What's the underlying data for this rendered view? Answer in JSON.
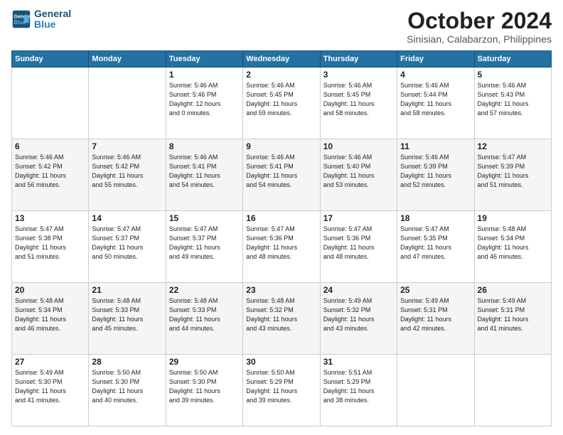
{
  "header": {
    "logo_line1": "General",
    "logo_line2": "Blue",
    "month_title": "October 2024",
    "subtitle": "Sinisian, Calabarzon, Philippines"
  },
  "days_of_week": [
    "Sunday",
    "Monday",
    "Tuesday",
    "Wednesday",
    "Thursday",
    "Friday",
    "Saturday"
  ],
  "weeks": [
    [
      {
        "num": "",
        "info": ""
      },
      {
        "num": "",
        "info": ""
      },
      {
        "num": "1",
        "info": "Sunrise: 5:46 AM\nSunset: 5:46 PM\nDaylight: 12 hours\nand 0 minutes."
      },
      {
        "num": "2",
        "info": "Sunrise: 5:46 AM\nSunset: 5:45 PM\nDaylight: 11 hours\nand 59 minutes."
      },
      {
        "num": "3",
        "info": "Sunrise: 5:46 AM\nSunset: 5:45 PM\nDaylight: 11 hours\nand 58 minutes."
      },
      {
        "num": "4",
        "info": "Sunrise: 5:46 AM\nSunset: 5:44 PM\nDaylight: 11 hours\nand 58 minutes."
      },
      {
        "num": "5",
        "info": "Sunrise: 5:46 AM\nSunset: 5:43 PM\nDaylight: 11 hours\nand 57 minutes."
      }
    ],
    [
      {
        "num": "6",
        "info": "Sunrise: 5:46 AM\nSunset: 5:42 PM\nDaylight: 11 hours\nand 56 minutes."
      },
      {
        "num": "7",
        "info": "Sunrise: 5:46 AM\nSunset: 5:42 PM\nDaylight: 11 hours\nand 55 minutes."
      },
      {
        "num": "8",
        "info": "Sunrise: 5:46 AM\nSunset: 5:41 PM\nDaylight: 11 hours\nand 54 minutes."
      },
      {
        "num": "9",
        "info": "Sunrise: 5:46 AM\nSunset: 5:41 PM\nDaylight: 11 hours\nand 54 minutes."
      },
      {
        "num": "10",
        "info": "Sunrise: 5:46 AM\nSunset: 5:40 PM\nDaylight: 11 hours\nand 53 minutes."
      },
      {
        "num": "11",
        "info": "Sunrise: 5:46 AM\nSunset: 5:39 PM\nDaylight: 11 hours\nand 52 minutes."
      },
      {
        "num": "12",
        "info": "Sunrise: 5:47 AM\nSunset: 5:39 PM\nDaylight: 11 hours\nand 51 minutes."
      }
    ],
    [
      {
        "num": "13",
        "info": "Sunrise: 5:47 AM\nSunset: 5:38 PM\nDaylight: 11 hours\nand 51 minutes."
      },
      {
        "num": "14",
        "info": "Sunrise: 5:47 AM\nSunset: 5:37 PM\nDaylight: 11 hours\nand 50 minutes."
      },
      {
        "num": "15",
        "info": "Sunrise: 5:47 AM\nSunset: 5:37 PM\nDaylight: 11 hours\nand 49 minutes."
      },
      {
        "num": "16",
        "info": "Sunrise: 5:47 AM\nSunset: 5:36 PM\nDaylight: 11 hours\nand 48 minutes."
      },
      {
        "num": "17",
        "info": "Sunrise: 5:47 AM\nSunset: 5:36 PM\nDaylight: 11 hours\nand 48 minutes."
      },
      {
        "num": "18",
        "info": "Sunrise: 5:47 AM\nSunset: 5:35 PM\nDaylight: 11 hours\nand 47 minutes."
      },
      {
        "num": "19",
        "info": "Sunrise: 5:48 AM\nSunset: 5:34 PM\nDaylight: 11 hours\nand 46 minutes."
      }
    ],
    [
      {
        "num": "20",
        "info": "Sunrise: 5:48 AM\nSunset: 5:34 PM\nDaylight: 11 hours\nand 46 minutes."
      },
      {
        "num": "21",
        "info": "Sunrise: 5:48 AM\nSunset: 5:33 PM\nDaylight: 11 hours\nand 45 minutes."
      },
      {
        "num": "22",
        "info": "Sunrise: 5:48 AM\nSunset: 5:33 PM\nDaylight: 11 hours\nand 44 minutes."
      },
      {
        "num": "23",
        "info": "Sunrise: 5:48 AM\nSunset: 5:32 PM\nDaylight: 11 hours\nand 43 minutes."
      },
      {
        "num": "24",
        "info": "Sunrise: 5:49 AM\nSunset: 5:32 PM\nDaylight: 11 hours\nand 43 minutes."
      },
      {
        "num": "25",
        "info": "Sunrise: 5:49 AM\nSunset: 5:31 PM\nDaylight: 11 hours\nand 42 minutes."
      },
      {
        "num": "26",
        "info": "Sunrise: 5:49 AM\nSunset: 5:31 PM\nDaylight: 11 hours\nand 41 minutes."
      }
    ],
    [
      {
        "num": "27",
        "info": "Sunrise: 5:49 AM\nSunset: 5:30 PM\nDaylight: 11 hours\nand 41 minutes."
      },
      {
        "num": "28",
        "info": "Sunrise: 5:50 AM\nSunset: 5:30 PM\nDaylight: 11 hours\nand 40 minutes."
      },
      {
        "num": "29",
        "info": "Sunrise: 5:50 AM\nSunset: 5:30 PM\nDaylight: 11 hours\nand 39 minutes."
      },
      {
        "num": "30",
        "info": "Sunrise: 5:50 AM\nSunset: 5:29 PM\nDaylight: 11 hours\nand 39 minutes."
      },
      {
        "num": "31",
        "info": "Sunrise: 5:51 AM\nSunset: 5:29 PM\nDaylight: 11 hours\nand 38 minutes."
      },
      {
        "num": "",
        "info": ""
      },
      {
        "num": "",
        "info": ""
      }
    ]
  ]
}
